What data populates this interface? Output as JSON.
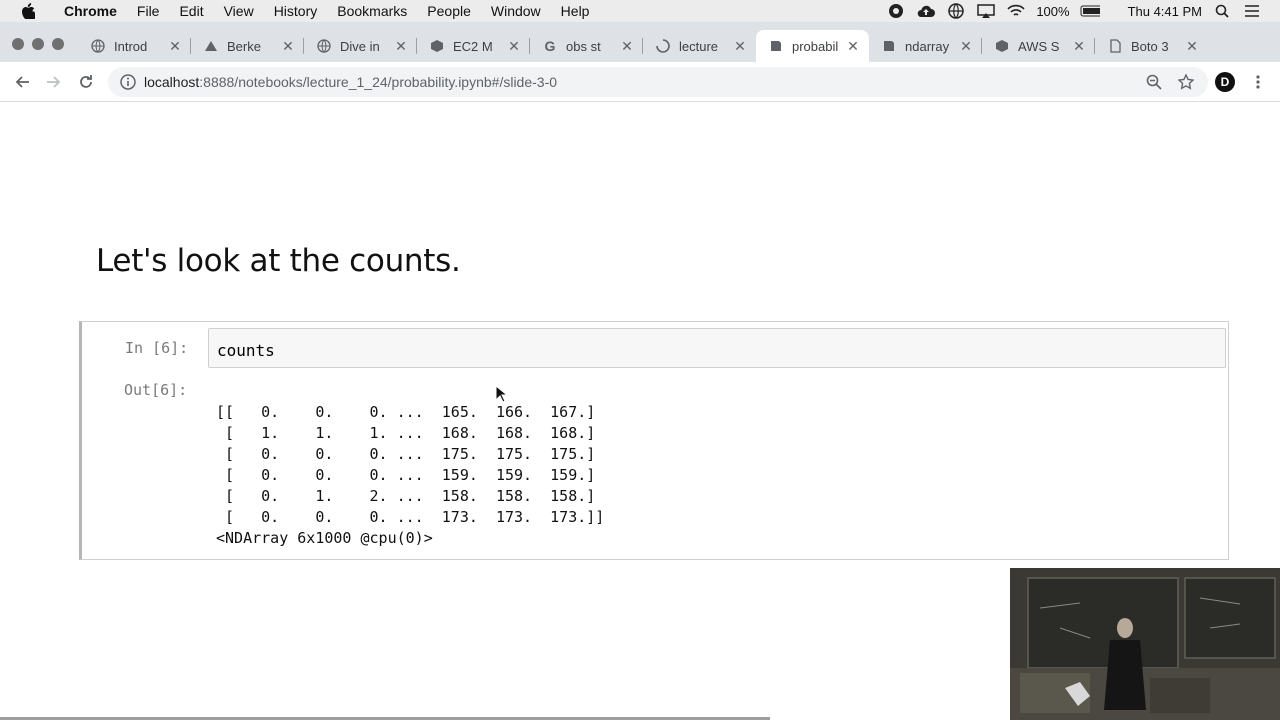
{
  "menubar": {
    "app_name": "Chrome",
    "items": [
      "File",
      "Edit",
      "View",
      "History",
      "Bookmarks",
      "People",
      "Window",
      "Help"
    ],
    "battery": "100%",
    "clock": "Thu 4:41 PM"
  },
  "tabs": [
    {
      "title": "Introd",
      "icon": "doc-icon"
    },
    {
      "title": "Berke",
      "icon": "berkeley-icon"
    },
    {
      "title": "Dive in",
      "icon": "globe-icon"
    },
    {
      "title": "EC2 M",
      "icon": "aws-icon"
    },
    {
      "title": "obs st",
      "icon": "google-icon"
    },
    {
      "title": "lecture",
      "icon": "loading-icon"
    },
    {
      "title": "probabil",
      "icon": "notebook-icon",
      "active": true
    },
    {
      "title": "ndarray",
      "icon": "notebook-icon"
    },
    {
      "title": "AWS S",
      "icon": "aws-icon"
    },
    {
      "title": "Boto 3",
      "icon": "doc-icon"
    }
  ],
  "omnibox": {
    "host": "localhost",
    "path": ":8888/notebooks/lecture_1_24/probability.ipynb#/slide-3-0"
  },
  "profile_initial": "D",
  "slide": {
    "heading": "Let's look at the counts."
  },
  "cell": {
    "in_prompt": "In [6]:",
    "code": "counts",
    "out_prompt": "Out[6]:",
    "output_lines": [
      "[[   0.    0.    0. ...  165.  166.  167.]",
      " [   1.    1.    1. ...  168.  168.  168.]",
      " [   0.    0.    0. ...  175.  175.  175.]",
      " [   0.    0.    0. ...  159.  159.  159.]",
      " [   0.    1.    2. ...  158.  158.  158.]",
      " [   0.    0.    0. ...  173.  173.  173.]]",
      "<NDArray 6x1000 @cpu(0)>"
    ]
  }
}
